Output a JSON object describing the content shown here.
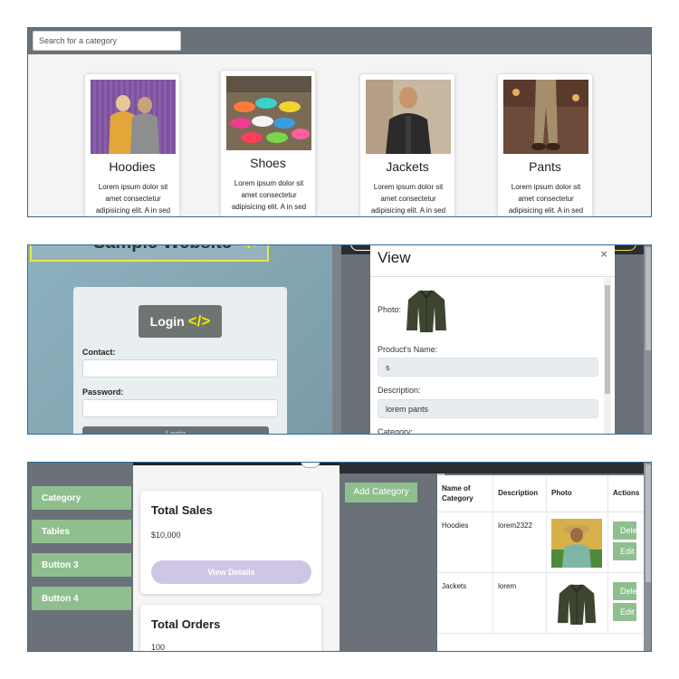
{
  "panel1": {
    "search": {
      "placeholder": "Search for a category"
    },
    "cards": [
      {
        "title": "Hoodies",
        "text": "Lorem ipsum dolor sit amet consectetur adipisicing elit. A in sed"
      },
      {
        "title": "Shoes",
        "text": "Lorem ipsum dolor sit amet consectetur adipisicing elit. A in sed"
      },
      {
        "title": "Jackets",
        "text": "Lorem ipsum dolor sit amet consectetur adipisicing elit. A in sed"
      },
      {
        "title": "Pants",
        "text": "Lorem ipsum dolor sit amet consectetur adipisicing elit. A in sed"
      }
    ]
  },
  "panel2": {
    "site_title": "Sample Website",
    "site_code": "</>",
    "login": {
      "button_label": "Login",
      "button_code": "</>",
      "contact_label": "Contact:",
      "password_label": "Password:",
      "submit_label": "Login"
    },
    "modal": {
      "title": "View",
      "close": "×",
      "photo_label": "Photo:",
      "name_label": "Product's Name:",
      "name_value": "s",
      "description_label": "Description:",
      "description_value": "lorem pants",
      "category_label": "Category:"
    }
  },
  "panel3": {
    "sidebar": [
      "Category",
      "Tables",
      "Button 3",
      "Button 4"
    ],
    "cards": [
      {
        "title": "Total Sales",
        "value": "$10,000",
        "button": "View Details"
      },
      {
        "title": "Total Orders",
        "value": "100"
      }
    ],
    "add_category": "Add Category",
    "table": {
      "headers": [
        "Name of Category",
        "Description",
        "Photo",
        "Actions"
      ],
      "rows": [
        {
          "name": "Hoodies",
          "description": "lorem2322",
          "delete": "Delete",
          "edit": "Edit"
        },
        {
          "name": "Jackets",
          "description": "lorem",
          "delete": "Delete",
          "edit": "Edit"
        }
      ]
    }
  },
  "colors": {
    "topbar": "#6b7178",
    "green_button": "#8fbf8f",
    "lavender_button": "#cfc6e6",
    "accent_yellow": "#f5e400",
    "panel_border": "#2f6f9a"
  }
}
